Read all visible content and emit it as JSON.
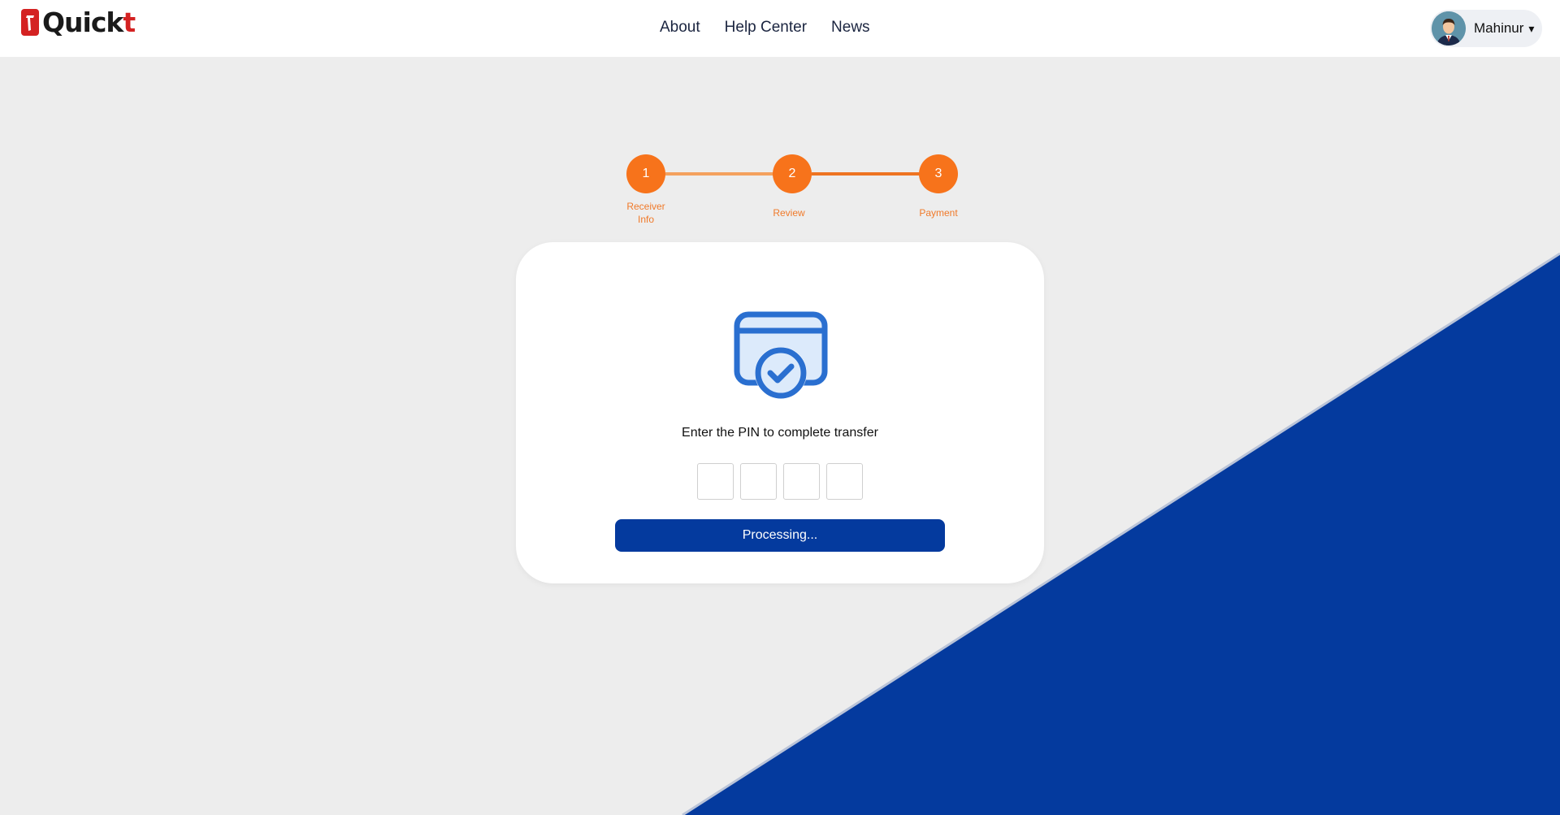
{
  "brand": {
    "name_main": "Quick",
    "name_accent": "t"
  },
  "nav": {
    "items": [
      {
        "label": "About"
      },
      {
        "label": "Help Center"
      },
      {
        "label": "News"
      }
    ]
  },
  "user": {
    "name": "Mahinur",
    "caret": "▾"
  },
  "stepper": {
    "steps": [
      {
        "number": "1",
        "label": "Receiver Info"
      },
      {
        "number": "2",
        "label": "Review"
      },
      {
        "number": "3",
        "label": "Payment"
      }
    ]
  },
  "card": {
    "instruction": "Enter the PIN to complete transfer",
    "pin_values": [
      "",
      "",
      "",
      ""
    ],
    "submit_label": "Processing..."
  },
  "colors": {
    "accent_orange": "#f7731b",
    "primary_blue": "#043a9e",
    "brand_red": "#d42222"
  }
}
